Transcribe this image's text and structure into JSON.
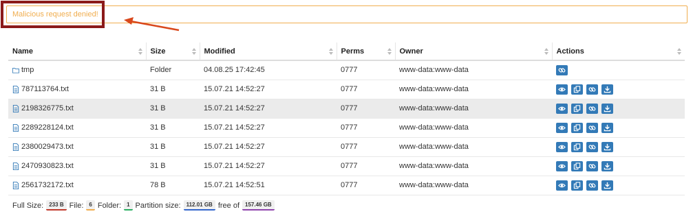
{
  "alert": {
    "message": "Malicious request denied!"
  },
  "table": {
    "columns": [
      "Name",
      "Size",
      "Modified",
      "Perms",
      "Owner",
      "Actions"
    ],
    "rows": [
      {
        "name": "tmp",
        "type": "folder",
        "size": "Folder",
        "modified": "04.08.25 17:42:45",
        "perms": "0777",
        "owner": "www-data:www-data"
      },
      {
        "name": "787113764.txt",
        "type": "file",
        "size": "31 B",
        "modified": "15.07.21 14:52:27",
        "perms": "0777",
        "owner": "www-data:www-data"
      },
      {
        "name": "2198326775.txt",
        "type": "file",
        "size": "31 B",
        "modified": "15.07.21 14:52:27",
        "perms": "0777",
        "owner": "www-data:www-data"
      },
      {
        "name": "2289228124.txt",
        "type": "file",
        "size": "31 B",
        "modified": "15.07.21 14:52:27",
        "perms": "0777",
        "owner": "www-data:www-data"
      },
      {
        "name": "2380029473.txt",
        "type": "file",
        "size": "31 B",
        "modified": "15.07.21 14:52:27",
        "perms": "0777",
        "owner": "www-data:www-data"
      },
      {
        "name": "2470930823.txt",
        "type": "file",
        "size": "31 B",
        "modified": "15.07.21 14:52:27",
        "perms": "0777",
        "owner": "www-data:www-data"
      },
      {
        "name": "2561732172.txt",
        "type": "file",
        "size": "78 B",
        "modified": "15.07.21 14:52:51",
        "perms": "0777",
        "owner": "www-data:www-data"
      }
    ],
    "file_actions": [
      "eye-icon",
      "copy-icon",
      "link-icon",
      "download-icon"
    ],
    "folder_actions": [
      "link-icon"
    ]
  },
  "footer": {
    "full_size_label": "Full Size:",
    "full_size": "233 B",
    "file_label": "File:",
    "file_count": "6",
    "folder_label": "Folder:",
    "folder_count": "1",
    "partition_label": "Partition size:",
    "partition_size": "112.01 GB",
    "free_label": "free of",
    "total_size": "157.46 GB"
  },
  "colors": {
    "accent": "#337ab7",
    "warning": "#f0ad4e",
    "annotation": "#8b1a1a",
    "arrow": "#d9481c"
  }
}
